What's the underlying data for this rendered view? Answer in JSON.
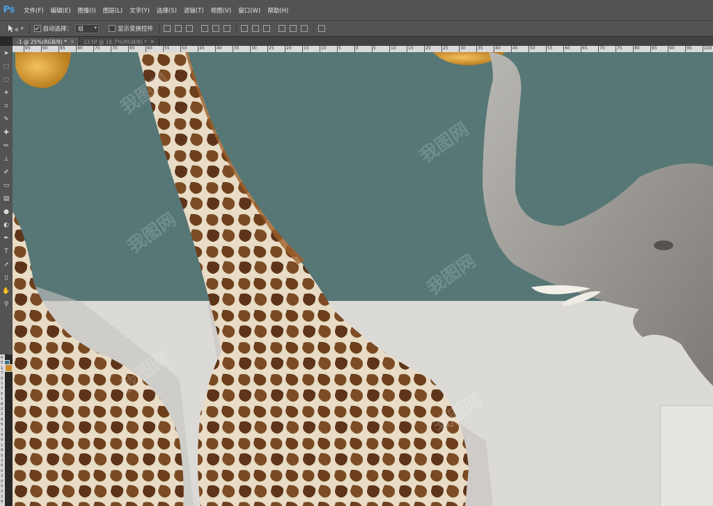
{
  "app": {
    "logo": "Ps"
  },
  "menu": [
    "文件(F)",
    "编辑(E)",
    "图像(I)",
    "图层(L)",
    "文字(Y)",
    "选择(S)",
    "滤镜(T)",
    "视图(V)",
    "窗口(W)",
    "帮助(H)"
  ],
  "options": {
    "auto_select_label": "自动选择：",
    "auto_select_checked": true,
    "auto_select_value": "组",
    "show_transform_label": "显示变换控件",
    "show_transform_checked": false
  },
  "tabs": [
    {
      "label": "-1 @ 25%(RGB/8) *",
      "active": true,
      "close": "×"
    },
    {
      "label": "13.tif @ 16.7%(RGB/8) *",
      "active": false,
      "close": "×"
    }
  ],
  "ruler_top_labels": [
    "95",
    "90",
    "85",
    "80",
    "75",
    "70",
    "65",
    "60",
    "55",
    "50",
    "45",
    "40",
    "35",
    "30",
    "25",
    "20",
    "15",
    "10",
    "5",
    "0",
    "5",
    "10",
    "15",
    "20",
    "25",
    "30",
    "35",
    "40",
    "45",
    "50",
    "55",
    "60",
    "65",
    "70",
    "75",
    "80",
    "85",
    "90",
    "95",
    "100"
  ],
  "ruler_left_labels": [
    "6",
    "5",
    "1",
    "7",
    "0",
    "1",
    "7",
    "5",
    "1",
    "8",
    "0",
    "1",
    "8",
    "5",
    "1",
    "9",
    "0",
    "1",
    "9",
    "5",
    "2",
    "0",
    "0",
    "2",
    "0",
    "5",
    "2",
    "1",
    "0"
  ],
  "tools": [
    "move-icon",
    "marquee-icon",
    "lasso-icon",
    "magic-wand-icon",
    "crop-icon",
    "eyedropper-icon",
    "healing-icon",
    "brush-icon",
    "stamp-icon",
    "history-brush-icon",
    "eraser-icon",
    "gradient-icon",
    "blur-icon",
    "dodge-icon",
    "pen-icon",
    "type-icon",
    "path-select-icon",
    "rectangle-icon",
    "hand-icon",
    "zoom-icon"
  ],
  "colors": {
    "foreground": "#3b6d89",
    "background": "#c98b2a",
    "wall": "#567776",
    "floor": "#dcdad7"
  },
  "watermark": "我图网"
}
